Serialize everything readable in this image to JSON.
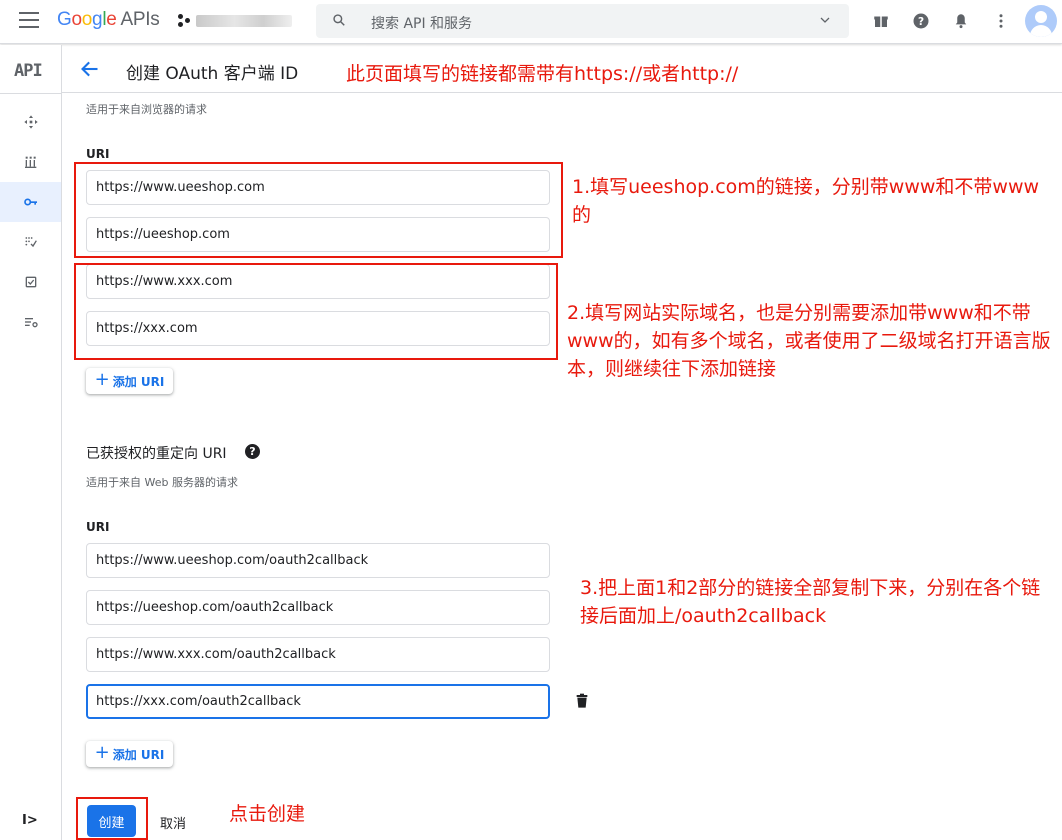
{
  "topbar": {
    "logo_google": [
      "G",
      "o",
      "o",
      "g",
      "l",
      "e"
    ],
    "logo_apis": "APIs",
    "search_placeholder": "搜索 API 和服务"
  },
  "sidebar": {
    "api_label": "API",
    "expand_label": "I>"
  },
  "header": {
    "title": "创建 OAuth 客户端 ID"
  },
  "js_origins": {
    "hint": "适用于来自浏览器的请求",
    "label": "URI",
    "uris": [
      "https://www.ueeshop.com",
      "https://ueeshop.com",
      "https://www.xxx.com",
      "https://xxx.com"
    ],
    "add_label": "添加 URI"
  },
  "redirect": {
    "title": "已获授权的重定向 URI",
    "help": "?",
    "hint": "适用于来自 Web 服务器的请求",
    "label": "URI",
    "uris": [
      "https://www.ueeshop.com/oauth2callback",
      "https://ueeshop.com/oauth2callback",
      "https://www.xxx.com/oauth2callback",
      "https://xxx.com/oauth2callback"
    ],
    "add_label": "添加 URI"
  },
  "actions": {
    "create_label": "创建",
    "cancel_label": "取消"
  },
  "annotations": {
    "top": "此页面填写的链接都需带有https://或者http://",
    "step1": "1.填写ueeshop.com的链接，分别带www和不带www的",
    "step2": "2.填写网站实际域名，也是分别需要添加带www和不带www的，如有多个域名，或者使用了二级域名打开语言版本，则继续往下添加链接",
    "step3": "3.把上面1和2部分的链接全部复制下来，分别在各个链接后面加上/oauth2callback",
    "click_create": "点击创建"
  },
  "colors": {
    "accent": "#1a73e8",
    "annotation_red": "#e8190d",
    "active_nav_bg": "#e8f0fe"
  }
}
